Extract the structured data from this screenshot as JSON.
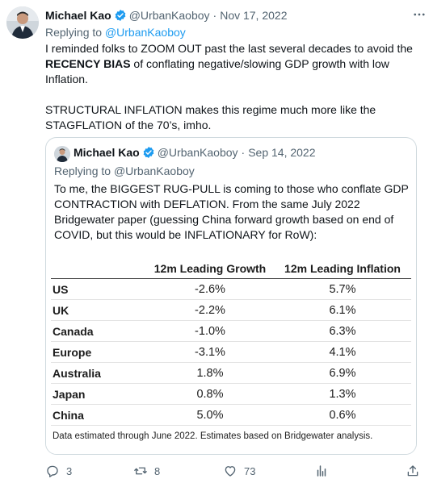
{
  "tweet": {
    "author_name": "Michael Kao",
    "handle": "@UrbanKaoboy",
    "separator": "·",
    "date": "Nov 17, 2022",
    "replying_prefix": "Replying to",
    "replying_to": "@UrbanKaoboy",
    "text_line1_a": "I reminded folks to ZOOM OUT past the last several decades to avoid the",
    "text_bold": "RECENCY BIAS",
    "text_line2_b": " of conflating negative/slowing GDP growth with low",
    "text_line3": "Inflation.",
    "text_para2": "STRUCTURAL INFLATION makes this regime much more like the STAGFLATION of the 70’s, imho."
  },
  "quote": {
    "author_name": "Michael Kao",
    "handle": "@UrbanKaoboy",
    "separator": "·",
    "date": "Sep 14, 2022",
    "replying_prefix": "Replying to",
    "replying_to": "@UrbanKaoboy",
    "text": "To me, the BIGGEST RUG-PULL is coming to those who conflate GDP CONTRACTION with DEFLATION. From the same July 2022 Bridgewater paper (guessing China forward growth based on end of COVID, but this would be INFLATIONARY for RoW):"
  },
  "table": {
    "headers": [
      "",
      "12m Leading Growth",
      "12m Leading Inflation"
    ],
    "rows": [
      {
        "country": "US",
        "growth": "-2.6%",
        "inflation": "5.7%"
      },
      {
        "country": "UK",
        "growth": "-2.2%",
        "inflation": "6.1%"
      },
      {
        "country": "Canada",
        "growth": "-1.0%",
        "inflation": "6.3%"
      },
      {
        "country": "Europe",
        "growth": "-3.1%",
        "inflation": "4.1%"
      },
      {
        "country": "Australia",
        "growth": "1.8%",
        "inflation": "6.9%"
      },
      {
        "country": "Japan",
        "growth": "0.8%",
        "inflation": "1.3%"
      },
      {
        "country": "China",
        "growth": "5.0%",
        "inflation": "0.6%"
      }
    ],
    "footnote": "Data estimated through June 2022. Estimates based on Bridgewater analysis."
  },
  "actions": {
    "replies": "3",
    "retweets": "8",
    "likes": "73"
  },
  "icons": [
    "verified-badge-icon",
    "more-icon",
    "reply-icon",
    "retweet-icon",
    "like-icon",
    "views-icon",
    "share-icon"
  ],
  "colors": {
    "accent": "#1d9bf0",
    "muted": "#536471",
    "border": "#cfd9de"
  }
}
